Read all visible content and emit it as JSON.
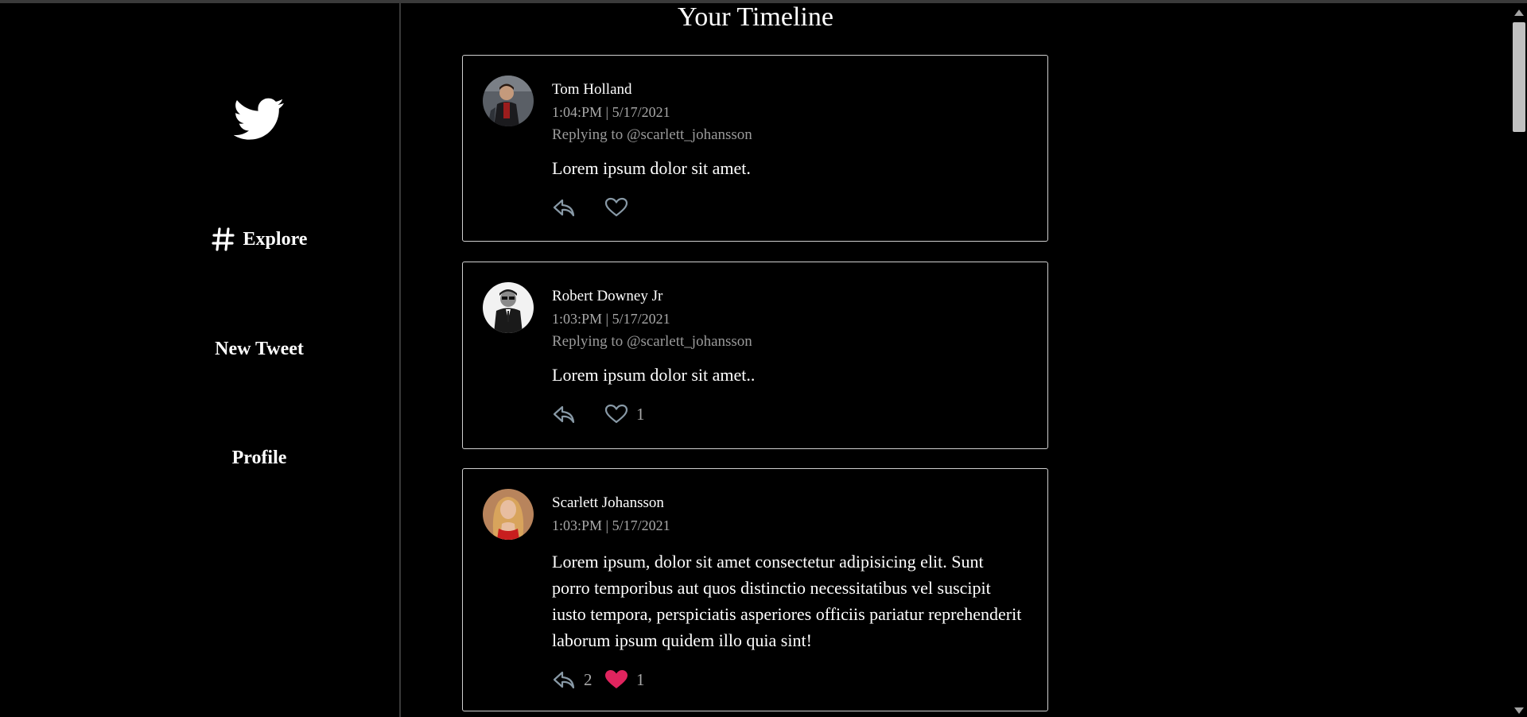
{
  "colors": {
    "background": "#000000",
    "border": "#d0d0d0",
    "muted_text": "#a8a8a8",
    "liked_heart": "#e0245e",
    "icon_gray": "#8899a6"
  },
  "sidebar": {
    "logo_icon": "twitter-bird-icon",
    "items": [
      {
        "label": "Explore",
        "icon": "hashtag-icon"
      },
      {
        "label": "New Tweet"
      },
      {
        "label": "Profile"
      }
    ]
  },
  "main": {
    "title": "Your Timeline",
    "tweets": [
      {
        "author": "Tom Holland",
        "timestamp": "1:04:PM | 5/17/2021",
        "replying_to": "Replying to @scarlett_johansson",
        "content": "Lorem ipsum dolor sit amet.",
        "reply_count": "",
        "like_count": "",
        "liked": false
      },
      {
        "author": "Robert Downey Jr",
        "timestamp": "1:03:PM | 5/17/2021",
        "replying_to": "Replying to @scarlett_johansson",
        "content": "Lorem ipsum dolor sit amet..",
        "reply_count": "",
        "like_count": "1",
        "liked": false
      },
      {
        "author": "Scarlett Johansson",
        "timestamp": "1:03:PM | 5/17/2021",
        "replying_to": "",
        "content": "Lorem ipsum, dolor sit amet consectetur adipisicing elit. Sunt porro temporibus aut quos distinctio necessitatibus vel suscipit iusto tempora, perspiciatis asperiores officiis pariatur reprehenderit laborum ipsum quidem illo quia sint!",
        "reply_count": "2",
        "like_count": "1",
        "liked": true
      }
    ]
  }
}
